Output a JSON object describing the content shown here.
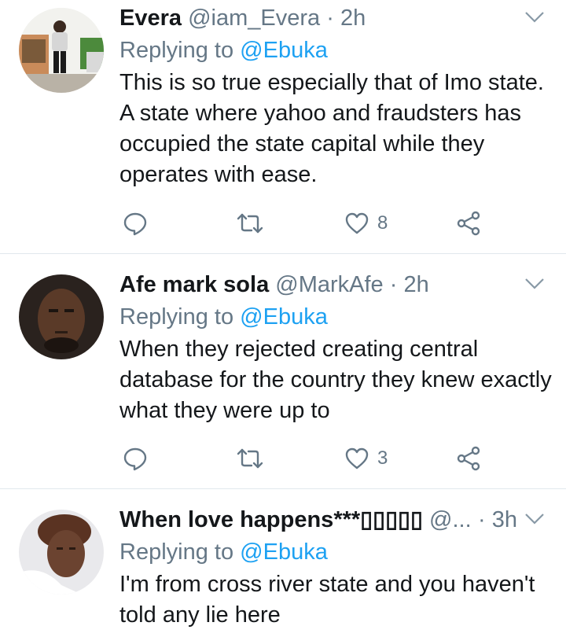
{
  "tweets": [
    {
      "name": "Evera",
      "handle": "@iam_Evera",
      "separator": "·",
      "time": "2h",
      "replying_prefix": "Replying to",
      "replying_to": "@Ebuka",
      "text": "This is so true especially that of Imo state. A state where yahoo and fraudsters has occupied the state capital while they operates with ease.",
      "likes": "8",
      "retweets": "",
      "replies": ""
    },
    {
      "name": "Afe mark sola",
      "handle": "@MarkAfe",
      "separator": "·",
      "time": "2h",
      "replying_prefix": "Replying to",
      "replying_to": "@Ebuka",
      "text": "When they rejected creating central database for the country they knew exactly what they were up to",
      "likes": "3",
      "retweets": "",
      "replies": ""
    },
    {
      "name": "When love happens***▯▯▯▯▯",
      "handle": "@...",
      "separator": "·",
      "time": "3h",
      "replying_prefix": "Replying to",
      "replying_to": "@Ebuka",
      "text": "I'm from cross river state and you haven't told any lie here"
    }
  ],
  "colors": {
    "link": "#1da1f2",
    "secondary": "#657786",
    "primary": "#14171a",
    "divider": "#e1e8ed"
  },
  "icons": [
    "reply-icon",
    "retweet-icon",
    "like-icon",
    "share-icon",
    "chevron-down-icon"
  ]
}
